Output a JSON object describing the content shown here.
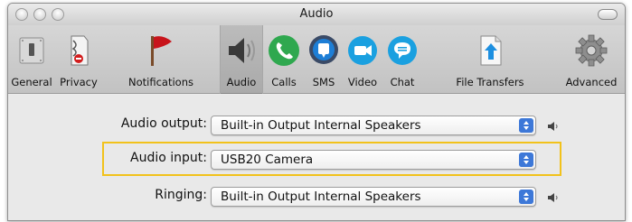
{
  "window": {
    "title": "Audio"
  },
  "toolbar": {
    "items": [
      {
        "label": "General",
        "icon": "switch-icon"
      },
      {
        "label": "Privacy",
        "icon": "privacy-icon"
      },
      {
        "label": "Notifications",
        "icon": "flag-icon"
      },
      {
        "label": "Audio",
        "icon": "speaker-icon",
        "selected": true
      },
      {
        "label": "Calls",
        "icon": "phone-icon"
      },
      {
        "label": "SMS",
        "icon": "sms-icon"
      },
      {
        "label": "Video",
        "icon": "video-camera-icon"
      },
      {
        "label": "Chat",
        "icon": "chat-bubble-icon"
      },
      {
        "label": "File Transfers",
        "icon": "file-transfer-icon"
      },
      {
        "label": "Advanced",
        "icon": "gear-icon"
      }
    ]
  },
  "audio": {
    "output_label": "Audio output:",
    "output_value": "Built-in Output Internal Speakers",
    "input_label": "Audio input:",
    "input_value": "USB20 Camera",
    "ringing_label": "Ringing:",
    "ringing_value": "Built-in Output Internal Speakers"
  },
  "colors": {
    "highlight": "#f2c21b",
    "calls_green": "#2fa84f",
    "sms_blue": "#1d7ed6",
    "video_blue": "#1aa0e0",
    "chat_blue": "#1aa0e0",
    "flag_red": "#c8141b"
  }
}
